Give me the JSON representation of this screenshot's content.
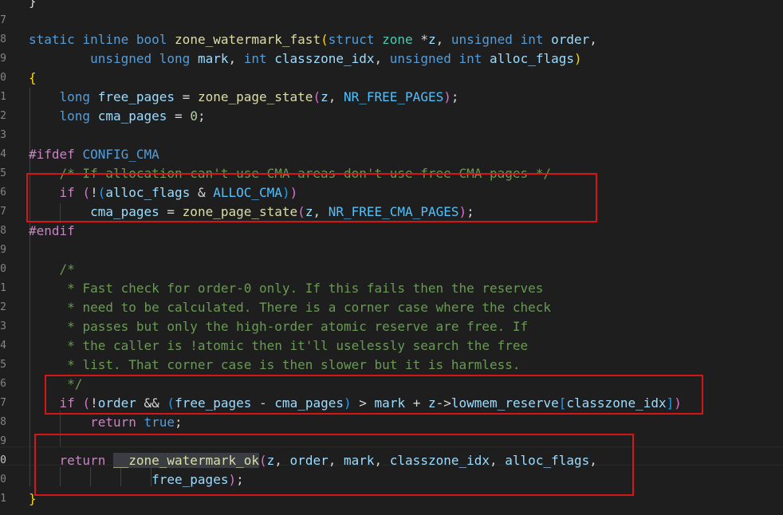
{
  "editor": {
    "language": "c",
    "line_numbers": [
      "",
      "7",
      "8",
      "9",
      "0",
      "1",
      "2",
      "3",
      "4",
      "5",
      "6",
      "7",
      "8",
      "9",
      "0",
      "1",
      "2",
      "3",
      "4",
      "5",
      "6",
      "7",
      "8",
      "9",
      "0",
      "0",
      "1"
    ],
    "active_line_number": "0",
    "lines": [
      {
        "tokens": [
          {
            "t": "}",
            "c": "pl"
          }
        ]
      },
      {
        "tokens": []
      },
      {
        "tokens": [
          {
            "t": "static",
            "c": "kw"
          },
          {
            "t": " ",
            "c": "pl"
          },
          {
            "t": "inline",
            "c": "kw"
          },
          {
            "t": " ",
            "c": "pl"
          },
          {
            "t": "bool",
            "c": "kw"
          },
          {
            "t": " ",
            "c": "pl"
          },
          {
            "t": "zone_watermark_fast",
            "c": "fn"
          },
          {
            "t": "(",
            "c": "b1"
          },
          {
            "t": "struct",
            "c": "kw"
          },
          {
            "t": " ",
            "c": "pl"
          },
          {
            "t": "zone",
            "c": "ty"
          },
          {
            "t": " *",
            "c": "pl"
          },
          {
            "t": "z",
            "c": "vr"
          },
          {
            "t": ", ",
            "c": "pl"
          },
          {
            "t": "unsigned",
            "c": "kw"
          },
          {
            "t": " ",
            "c": "pl"
          },
          {
            "t": "int",
            "c": "kw"
          },
          {
            "t": " ",
            "c": "pl"
          },
          {
            "t": "order",
            "c": "vr"
          },
          {
            "t": ",",
            "c": "pl"
          }
        ]
      },
      {
        "tokens": [
          {
            "t": "        ",
            "c": "pl"
          },
          {
            "t": "unsigned",
            "c": "kw"
          },
          {
            "t": " ",
            "c": "pl"
          },
          {
            "t": "long",
            "c": "kw"
          },
          {
            "t": " ",
            "c": "pl"
          },
          {
            "t": "mark",
            "c": "vr"
          },
          {
            "t": ", ",
            "c": "pl"
          },
          {
            "t": "int",
            "c": "kw"
          },
          {
            "t": " ",
            "c": "pl"
          },
          {
            "t": "classzone_idx",
            "c": "vr"
          },
          {
            "t": ", ",
            "c": "pl"
          },
          {
            "t": "unsigned",
            "c": "kw"
          },
          {
            "t": " ",
            "c": "pl"
          },
          {
            "t": "int",
            "c": "kw"
          },
          {
            "t": " ",
            "c": "pl"
          },
          {
            "t": "alloc_flags",
            "c": "vr"
          },
          {
            "t": ")",
            "c": "b1"
          }
        ]
      },
      {
        "tokens": [
          {
            "t": "{",
            "c": "b1"
          }
        ]
      },
      {
        "tokens": [
          {
            "t": "    ",
            "c": "pl"
          },
          {
            "t": "long",
            "c": "kw"
          },
          {
            "t": " ",
            "c": "pl"
          },
          {
            "t": "free_pages",
            "c": "vr"
          },
          {
            "t": " = ",
            "c": "pl"
          },
          {
            "t": "zone_page_state",
            "c": "fn"
          },
          {
            "t": "(",
            "c": "b2"
          },
          {
            "t": "z",
            "c": "vr"
          },
          {
            "t": ", ",
            "c": "pl"
          },
          {
            "t": "NR_FREE_PAGES",
            "c": "co"
          },
          {
            "t": ")",
            "c": "b2"
          },
          {
            "t": ";",
            "c": "pl"
          }
        ]
      },
      {
        "tokens": [
          {
            "t": "    ",
            "c": "pl"
          },
          {
            "t": "long",
            "c": "kw"
          },
          {
            "t": " ",
            "c": "pl"
          },
          {
            "t": "cma_pages",
            "c": "vr"
          },
          {
            "t": " = ",
            "c": "pl"
          },
          {
            "t": "0",
            "c": "nm"
          },
          {
            "t": ";",
            "c": "pl"
          }
        ]
      },
      {
        "tokens": []
      },
      {
        "tokens": [
          {
            "t": "#ifdef",
            "c": "pp"
          },
          {
            "t": " ",
            "c": "pl"
          },
          {
            "t": "CONFIG_CMA",
            "c": "kw"
          }
        ]
      },
      {
        "tokens": [
          {
            "t": "    ",
            "c": "pl"
          },
          {
            "t": "/* If allocation can't use CMA areas don't use free CMA pages */",
            "c": "cm strike"
          }
        ]
      },
      {
        "tokens": [
          {
            "t": "    ",
            "c": "pl"
          },
          {
            "t": "if",
            "c": "ctl"
          },
          {
            "t": " ",
            "c": "pl"
          },
          {
            "t": "(",
            "c": "b2"
          },
          {
            "t": "!",
            "c": "pl"
          },
          {
            "t": "(",
            "c": "b3"
          },
          {
            "t": "alloc_flags",
            "c": "vr"
          },
          {
            "t": " & ",
            "c": "pl"
          },
          {
            "t": "ALLOC_CMA",
            "c": "co"
          },
          {
            "t": ")",
            "c": "b3"
          },
          {
            "t": ")",
            "c": "b2"
          }
        ]
      },
      {
        "tokens": [
          {
            "t": "        ",
            "c": "pl"
          },
          {
            "t": "cma_pages",
            "c": "vr"
          },
          {
            "t": " = ",
            "c": "pl"
          },
          {
            "t": "zone_page_state",
            "c": "fn"
          },
          {
            "t": "(",
            "c": "b2"
          },
          {
            "t": "z",
            "c": "vr"
          },
          {
            "t": ", ",
            "c": "pl"
          },
          {
            "t": "NR_FREE_CMA_PAGES",
            "c": "co"
          },
          {
            "t": ")",
            "c": "b2"
          },
          {
            "t": ";",
            "c": "pl"
          }
        ]
      },
      {
        "tokens": [
          {
            "t": "#endif",
            "c": "pp"
          }
        ]
      },
      {
        "tokens": []
      },
      {
        "tokens": [
          {
            "t": "    ",
            "c": "pl"
          },
          {
            "t": "/*",
            "c": "cm"
          }
        ]
      },
      {
        "tokens": [
          {
            "t": "     ",
            "c": "pl"
          },
          {
            "t": "* Fast check for order-0 only. If this fails then the reserves",
            "c": "cm"
          }
        ]
      },
      {
        "tokens": [
          {
            "t": "     ",
            "c": "pl"
          },
          {
            "t": "* need to be calculated. There is a corner case where the check",
            "c": "cm"
          }
        ]
      },
      {
        "tokens": [
          {
            "t": "     ",
            "c": "pl"
          },
          {
            "t": "* passes but only the high-order atomic reserve are free. If",
            "c": "cm"
          }
        ]
      },
      {
        "tokens": [
          {
            "t": "     ",
            "c": "pl"
          },
          {
            "t": "* the caller is !atomic then it'll uselessly search the free",
            "c": "cm"
          }
        ]
      },
      {
        "tokens": [
          {
            "t": "     ",
            "c": "pl"
          },
          {
            "t": "* list. That corner case is then slower but it is harmless.",
            "c": "cm"
          }
        ]
      },
      {
        "tokens": [
          {
            "t": "     ",
            "c": "pl"
          },
          {
            "t": "*/",
            "c": "cm"
          }
        ]
      },
      {
        "tokens": [
          {
            "t": "    ",
            "c": "pl"
          },
          {
            "t": "if",
            "c": "ctl"
          },
          {
            "t": " ",
            "c": "pl"
          },
          {
            "t": "(",
            "c": "b2"
          },
          {
            "t": "!",
            "c": "pl"
          },
          {
            "t": "order",
            "c": "vr"
          },
          {
            "t": " && ",
            "c": "pl"
          },
          {
            "t": "(",
            "c": "b3"
          },
          {
            "t": "free_pages",
            "c": "vr"
          },
          {
            "t": " - ",
            "c": "pl"
          },
          {
            "t": "cma_pages",
            "c": "vr"
          },
          {
            "t": ")",
            "c": "b3"
          },
          {
            "t": " > ",
            "c": "pl"
          },
          {
            "t": "mark",
            "c": "vr"
          },
          {
            "t": " + ",
            "c": "pl"
          },
          {
            "t": "z",
            "c": "vr"
          },
          {
            "t": "->",
            "c": "pl"
          },
          {
            "t": "lowmem_reserve",
            "c": "vr"
          },
          {
            "t": "[",
            "c": "b3"
          },
          {
            "t": "classzone_idx",
            "c": "vr"
          },
          {
            "t": "]",
            "c": "b3"
          },
          {
            "t": ")",
            "c": "b2"
          }
        ]
      },
      {
        "tokens": [
          {
            "t": "        ",
            "c": "pl"
          },
          {
            "t": "return",
            "c": "ctl"
          },
          {
            "t": " ",
            "c": "pl"
          },
          {
            "t": "true",
            "c": "kw"
          },
          {
            "t": ";",
            "c": "pl"
          }
        ]
      },
      {
        "tokens": []
      },
      {
        "tokens": [
          {
            "t": "    ",
            "c": "pl"
          },
          {
            "t": "return",
            "c": "ctl"
          },
          {
            "t": " ",
            "c": "pl"
          },
          {
            "t": "__zone_watermark_ok",
            "c": "fn sel"
          },
          {
            "t": "(",
            "c": "b2"
          },
          {
            "t": "z",
            "c": "vr"
          },
          {
            "t": ", ",
            "c": "pl"
          },
          {
            "t": "order",
            "c": "vr"
          },
          {
            "t": ", ",
            "c": "pl"
          },
          {
            "t": "mark",
            "c": "vr"
          },
          {
            "t": ", ",
            "c": "pl"
          },
          {
            "t": "classzone_idx",
            "c": "vr"
          },
          {
            "t": ", ",
            "c": "pl"
          },
          {
            "t": "alloc_flags",
            "c": "vr"
          },
          {
            "t": ",",
            "c": "pl"
          }
        ]
      },
      {
        "tokens": [
          {
            "t": "                ",
            "c": "pl"
          },
          {
            "t": "free_pages",
            "c": "vr"
          },
          {
            "t": ")",
            "c": "b2"
          },
          {
            "t": ";",
            "c": "pl"
          }
        ]
      },
      {
        "tokens": [
          {
            "t": "}",
            "c": "b1"
          }
        ]
      }
    ]
  },
  "colors": {
    "background": "#1e1e1e",
    "highlight_box": "#d51616",
    "keyword": "#569cd6",
    "function": "#dcdcaa",
    "variable": "#9cdcfe",
    "constant": "#4fc1ff",
    "comment": "#6a9955",
    "preprocessor": "#c586c0"
  }
}
